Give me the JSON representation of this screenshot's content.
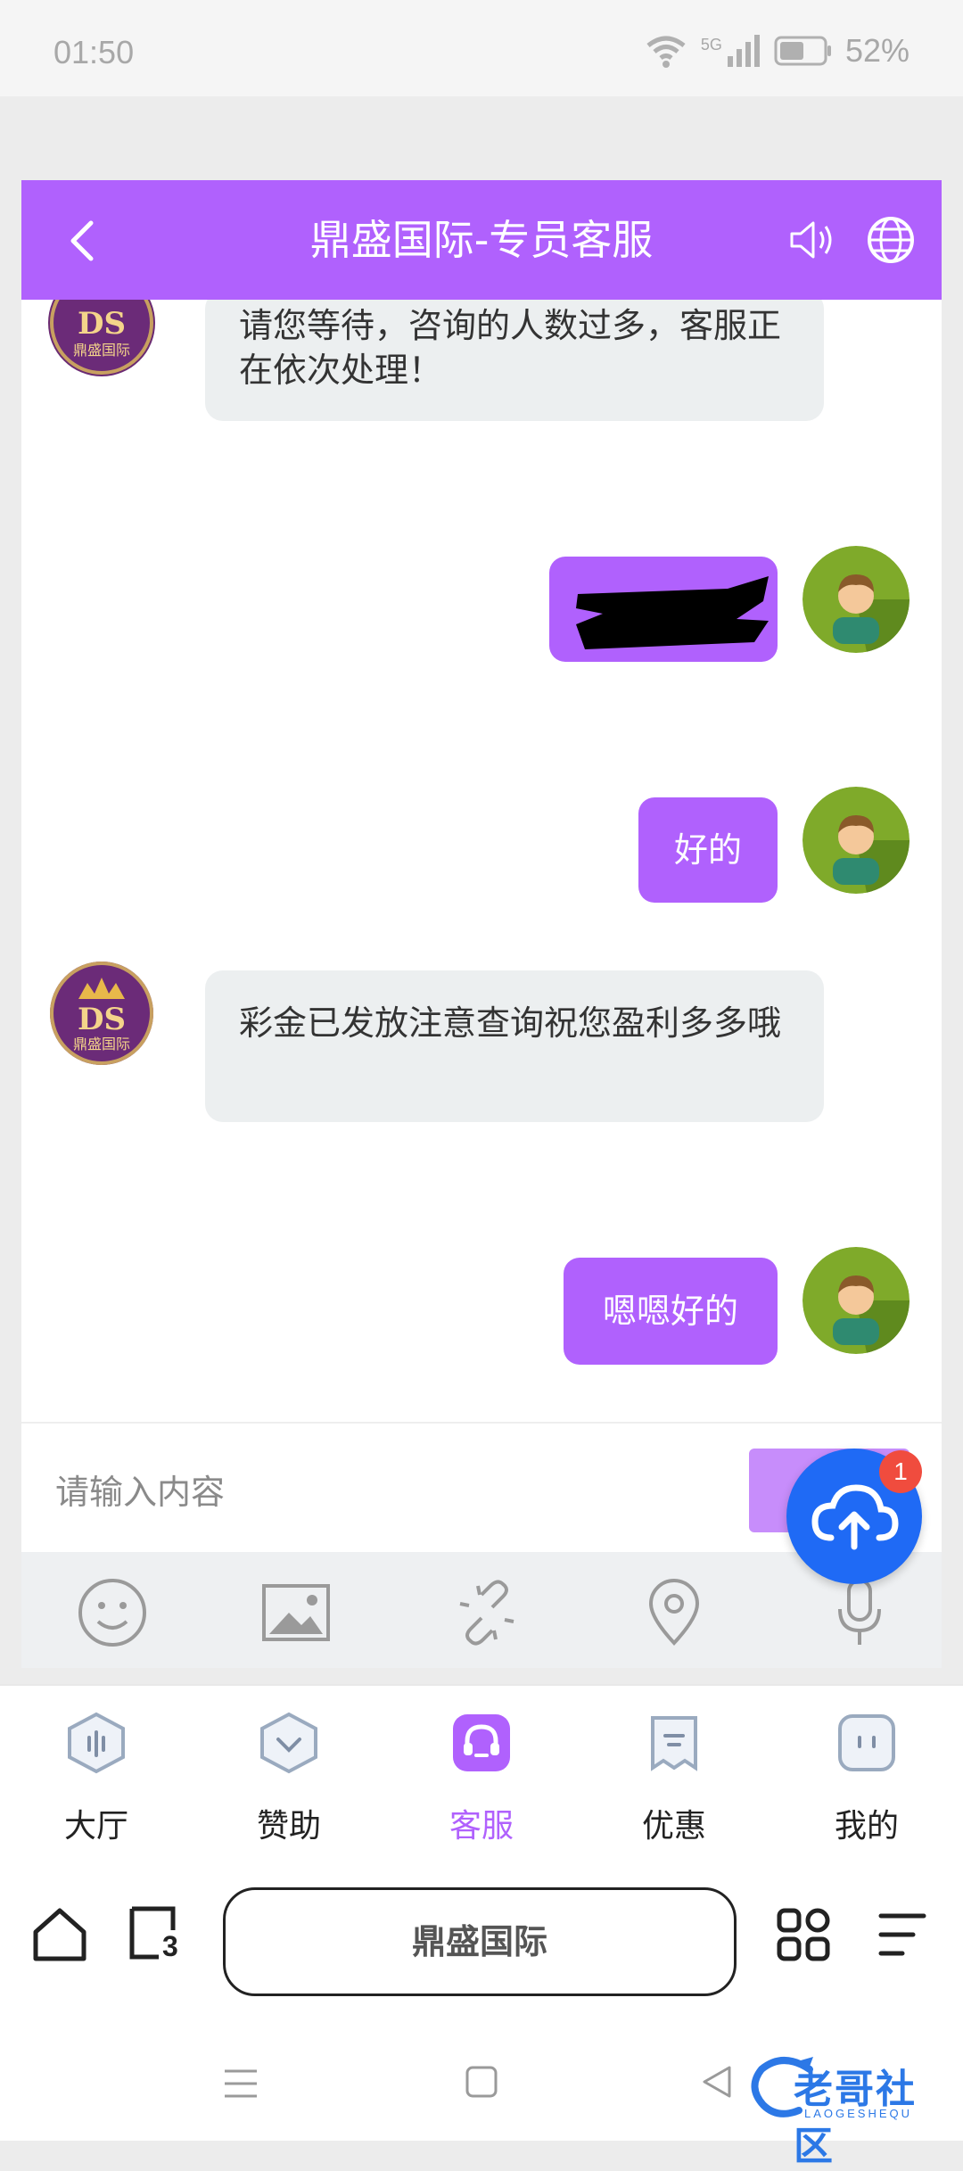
{
  "status": {
    "time": "01:50",
    "network": "5G",
    "battery": "52%"
  },
  "header": {
    "title": "鼎盛国际-专员客服",
    "back_icon": "chevron-left-icon",
    "sound_icon": "speaker-icon",
    "globe_icon": "globe-icon"
  },
  "messages": [
    {
      "side": "in",
      "text": "请您等待，咨询的人数过多，客服正在依次处理！"
    },
    {
      "side": "out",
      "text": "",
      "redacted": true
    },
    {
      "side": "out",
      "text": "好的"
    },
    {
      "side": "in",
      "text": "彩金已发放注意查询祝您盈利多多哦"
    },
    {
      "side": "out",
      "text": "嗯嗯好的"
    }
  ],
  "agent_logo": {
    "letters": "DS",
    "name": "鼎盛国际"
  },
  "input": {
    "placeholder": "请输入内容"
  },
  "fab": {
    "badge": "1"
  },
  "tabs": [
    {
      "label": "大厅",
      "icon": "lobby-icon",
      "active": false
    },
    {
      "label": "赞助",
      "icon": "sponsor-icon",
      "active": false
    },
    {
      "label": "客服",
      "icon": "headset-icon",
      "active": true
    },
    {
      "label": "优惠",
      "icon": "promotion-icon",
      "active": false
    },
    {
      "label": "我的",
      "icon": "profile-icon",
      "active": false
    }
  ],
  "browser": {
    "address": "鼎盛国际",
    "tab_count": "3"
  },
  "watermark": {
    "text": "老哥社区",
    "sub": "LAOGESHEQU"
  },
  "colors": {
    "accent": "#b061fd",
    "fab": "#1f6af5",
    "badge": "#f04c3e"
  }
}
